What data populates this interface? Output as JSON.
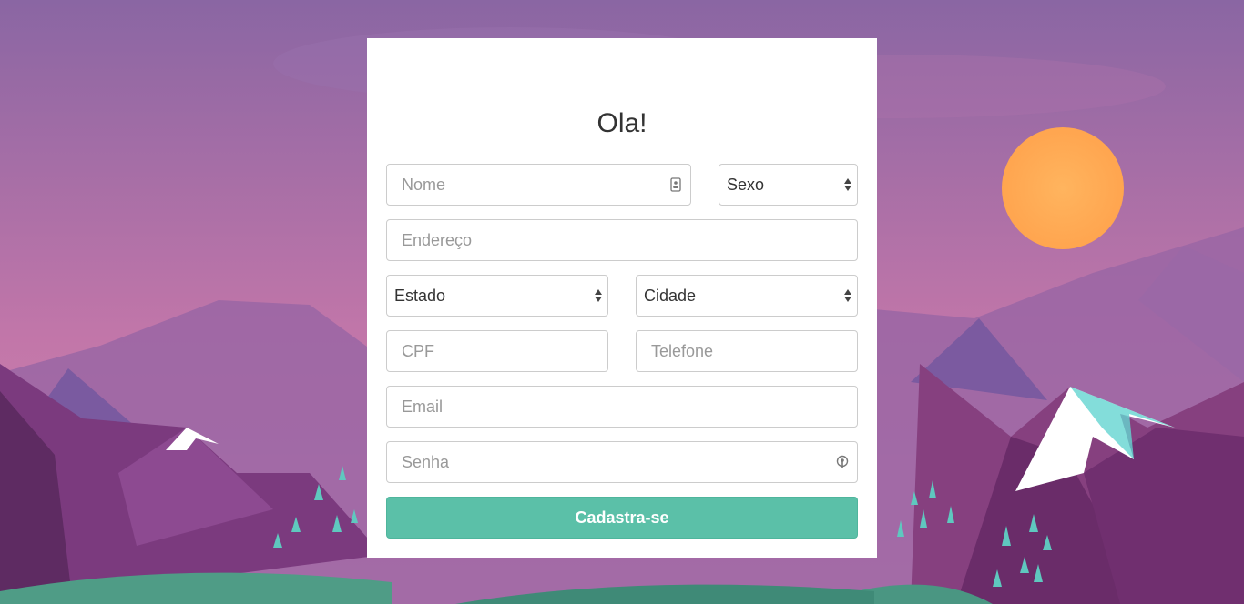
{
  "form": {
    "title": "Ola!",
    "nome_placeholder": "Nome",
    "sexo_value": "Sexo",
    "endereco_placeholder": "Endereço",
    "estado_value": "Estado",
    "cidade_value": "Cidade",
    "cpf_placeholder": "CPF",
    "telefone_placeholder": "Telefone",
    "email_placeholder": "Email",
    "senha_placeholder": "Senha",
    "submit_label": "Cadastra-se"
  },
  "icons": {
    "nome_field": "contact-card-icon",
    "senha_field": "password-key-icon",
    "select_arrows": "up-down-arrows-icon"
  },
  "colors": {
    "accent": "#5bc0a8",
    "sky_top": "#8a66a3",
    "sky_bottom": "#d07ea7",
    "sun": "#ffac55",
    "card": "#ffffff"
  }
}
